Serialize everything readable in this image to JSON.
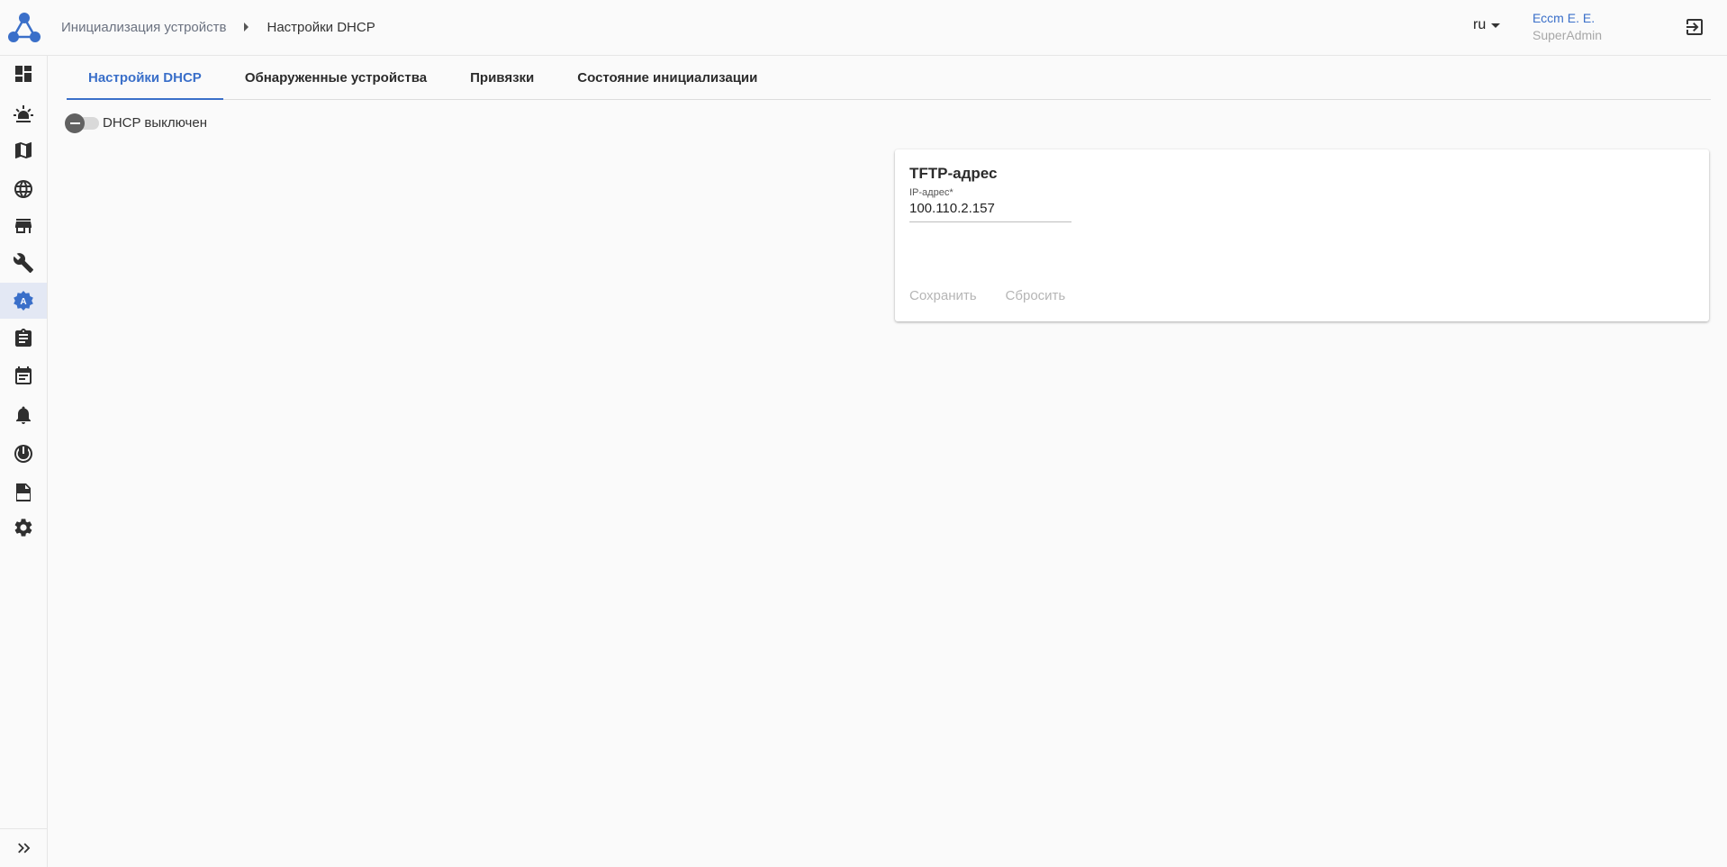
{
  "header": {
    "breadcrumb": [
      {
        "label": "Инициализация устройств"
      },
      {
        "label": "Настройки DHCP"
      }
    ],
    "language": "ru",
    "user": {
      "name": "Ессm E. E.",
      "role": "SuperAdmin"
    },
    "logo_icon": "network-nodes-logo",
    "logout_icon": "logout-icon"
  },
  "sidebar": {
    "items": [
      {
        "icon": "dashboard-icon"
      },
      {
        "icon": "alarm-light-icon"
      },
      {
        "icon": "map-icon"
      },
      {
        "icon": "globe-icon"
      },
      {
        "icon": "store-icon"
      },
      {
        "icon": "wrench-icon"
      },
      {
        "icon": "auto-init-icon",
        "active": true
      },
      {
        "icon": "clipboard-icon"
      },
      {
        "icon": "calendar-icon"
      },
      {
        "icon": "bell-icon"
      },
      {
        "icon": "power-icon"
      },
      {
        "icon": "log-icon"
      },
      {
        "icon": "gear-icon"
      }
    ],
    "expand_icon": "double-chevron-right-icon"
  },
  "tabs": [
    {
      "label": "Настройки DHCP",
      "active": true
    },
    {
      "label": "Обнаруженные устройства"
    },
    {
      "label": "Привязки"
    },
    {
      "label": "Состояние инициализации"
    }
  ],
  "dhcp_toggle": {
    "label": "DHCP выключен",
    "on": false
  },
  "tftp_card": {
    "title": "TFTP-адрес",
    "ip_label": "IP-адрес*",
    "ip_value": "100.110.2.157",
    "save_label": "Сохранить",
    "reset_label": "Сбросить"
  },
  "colors": {
    "accent": "#3a6fc9",
    "active_bg": "#e3e8f4",
    "muted": "#b5b5b5"
  }
}
